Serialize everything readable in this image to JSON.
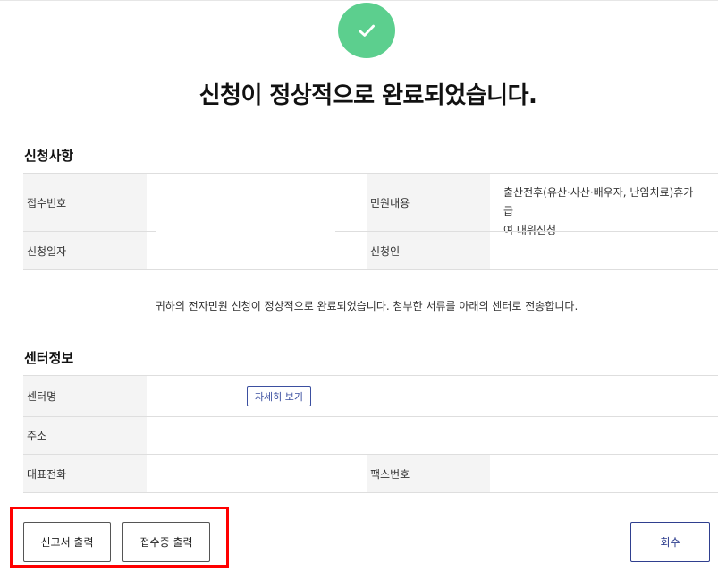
{
  "page": {
    "title": "신청이 정상적으로 완료되었습니다.",
    "notice": "귀하의 전자민원 신청이 정상적으로 완료되었습니다. 첨부한 서류를 아래의 센터로 전송합니다."
  },
  "application": {
    "heading": "신청사항",
    "receipt_no_label": "접수번호",
    "receipt_no_value": "",
    "content_label": "민원내용",
    "content_value_line1": "출산전후(유산·사산·배우자, 난임치료)휴가 급",
    "content_value_line2": "여 대위신청",
    "date_label": "신청일자",
    "date_value": "",
    "applicant_label": "신청인",
    "applicant_value": ""
  },
  "center": {
    "heading": "센터정보",
    "name_label": "센터명",
    "detail_button": "자세히 보기",
    "address_label": "주소",
    "phone_label": "대표전화",
    "fax_label": "팩스번호"
  },
  "actions": {
    "print_report": "신고서 출력",
    "print_receipt": "접수증 출력",
    "withdraw": "회수"
  },
  "colors": {
    "check_green": "#5ccf8e",
    "accent_blue": "#3b4fa0",
    "highlight_red": "#ff0000"
  }
}
